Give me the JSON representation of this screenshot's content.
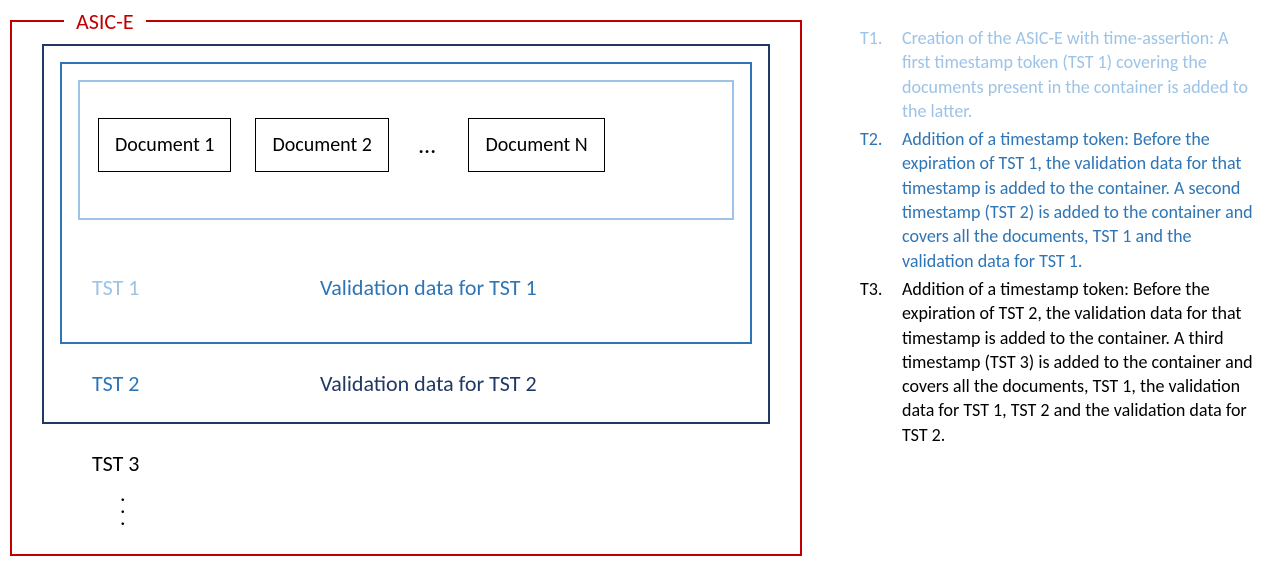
{
  "asic": {
    "title": "ASIC-E"
  },
  "documents": {
    "d1": "Document 1",
    "d2": "Document 2",
    "dots": "…",
    "dn": "Document N"
  },
  "layers": {
    "tst1": "TST 1",
    "val1": "Validation data for TST 1",
    "tst2": "TST 2",
    "val2": "Validation data for TST 2",
    "tst3": "TST 3"
  },
  "vdots": "⋮",
  "legend": {
    "t1": {
      "num": "T1.",
      "text": "Creation of the ASIC-E with time-assertion: A first timestamp token (TST 1) covering the documents present in the container is added to the latter."
    },
    "t2": {
      "num": "T2.",
      "text": "Addition of a timestamp token: Before the expiration of TST 1, the validation data for that timestamp is added to the container. A second timestamp (TST 2) is added to the container and covers all the documents, TST 1 and the validation data for TST 1."
    },
    "t3": {
      "num": "T3.",
      "text": "Addition of a timestamp token: Before the expiration of TST 2, the validation data for that timestamp is added to the container. A third timestamp (TST 3) is added to the container and covers all the documents, TST 1, the validation data for TST 1, TST 2 and the validation data for TST 2."
    }
  }
}
